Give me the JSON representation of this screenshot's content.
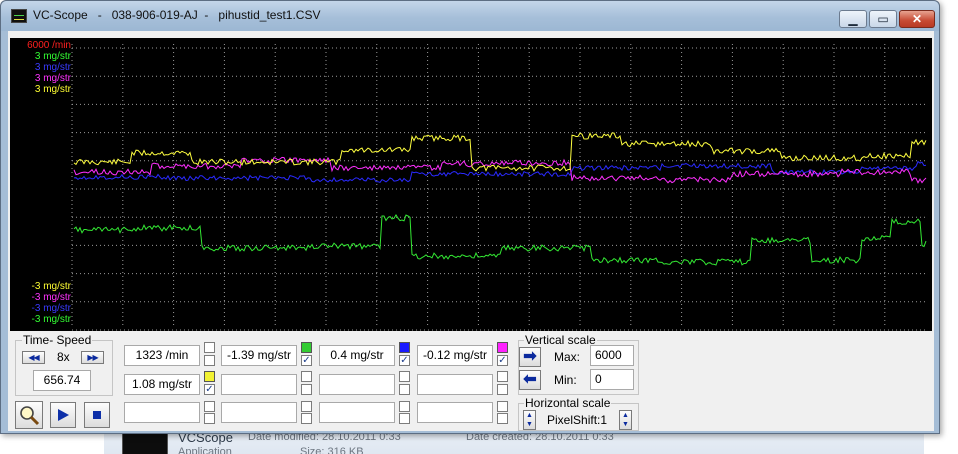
{
  "window": {
    "title": "VC-Scope   -   038-906-019-AJ  -   pihustid_test1.CSV",
    "minimize": "▁",
    "maximize": "▭",
    "close": "✕"
  },
  "scope": {
    "scale_top": [
      {
        "text": "6000 /min",
        "color": "#ff2020"
      },
      {
        "text": "3 mg/str",
        "color": "#33ff33"
      },
      {
        "text": "3 mg/str",
        "color": "#3a3aff"
      },
      {
        "text": "3 mg/str",
        "color": "#ff33ff"
      },
      {
        "text": "3 mg/str",
        "color": "#ffff33"
      }
    ],
    "scale_bottom": [
      {
        "text": "-3 mg/str",
        "color": "#ffff33"
      },
      {
        "text": "-3 mg/str",
        "color": "#ff33ff"
      },
      {
        "text": "-3 mg/str",
        "color": "#3a3aff"
      },
      {
        "text": "-3 mg/str",
        "color": "#33ff33"
      }
    ],
    "colors": {
      "grid": "#9a9a9a",
      "yellow": "#ffff40",
      "magenta": "#ff30ff",
      "blue": "#2a2aff",
      "green": "#33e833"
    }
  },
  "time_speed": {
    "title": "Time- Speed",
    "rewind_icon": "rewind-icon",
    "forward_icon": "fast-forward-icon",
    "zoom": "8x",
    "position": "656.74"
  },
  "channels": {
    "row1": [
      {
        "value": "1323 /min",
        "swatch": null,
        "checked": false
      },
      {
        "value": "-1.39 mg/str",
        "swatch": "#33cc33",
        "checked": true
      },
      {
        "value": "0.4 mg/str",
        "swatch": "#1a1aff",
        "checked": true
      },
      {
        "value": "-0.12 mg/str",
        "swatch": "#ff22ff",
        "checked": true
      }
    ],
    "row2": [
      {
        "value": "1.08 mg/str",
        "swatch": "#f2f233",
        "checked": true
      },
      {
        "value": "",
        "swatch": null,
        "checked": false
      },
      {
        "value": "",
        "swatch": null,
        "checked": false
      },
      {
        "value": "",
        "swatch": null,
        "checked": false
      }
    ],
    "row3": [
      {
        "value": "",
        "checked": false
      },
      {
        "value": "",
        "checked": false
      },
      {
        "value": "",
        "checked": false
      },
      {
        "value": "",
        "checked": false
      }
    ]
  },
  "vertical_scale": {
    "title": "Vertical scale",
    "max_label": "Max:",
    "max_value": "6000",
    "min_label": "Min:",
    "min_value": "0"
  },
  "horizontal_scale": {
    "title": "Horizontal scale",
    "pixel_shift": "PixelShift:1"
  },
  "explorer": {
    "name": "VCScope",
    "date_modified": "Date modified: 28.10.2011 0:33",
    "date_created": "Date created: 28.10.2011 0:33",
    "type": "Application",
    "size": "Size: 316 KB"
  }
}
